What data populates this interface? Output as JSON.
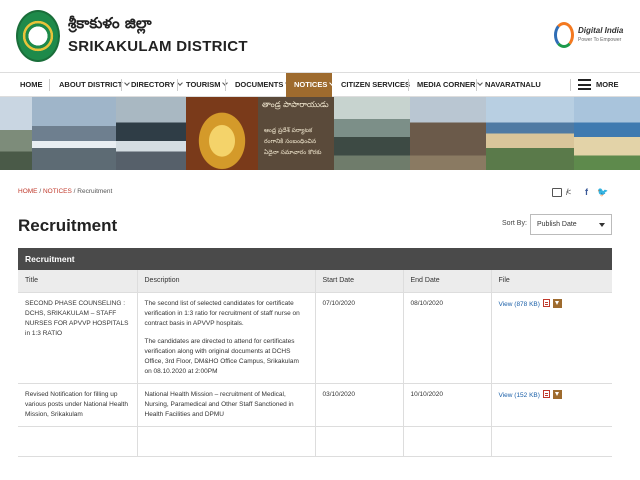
{
  "header": {
    "district_telugu": "శ్రీకాకుళం జిల్లా",
    "district_name": "SRIKAKULAM DISTRICT",
    "digital_india_title": "Digital India",
    "digital_india_tagline": "Power To Empower"
  },
  "nav": {
    "items": [
      {
        "label": "HOME"
      },
      {
        "label": "ABOUT DISTRICT"
      },
      {
        "label": "DIRECTORY"
      },
      {
        "label": "TOURISM"
      },
      {
        "label": "DOCUMENTS"
      },
      {
        "label": "NOTICES"
      },
      {
        "label": "CITIZEN SERVICES"
      },
      {
        "label": "MEDIA CORNER"
      },
      {
        "label": "NAVARATNALU"
      }
    ],
    "more_label": "MORE",
    "active_color": "#9e6b2e"
  },
  "banner": {
    "heading": "తాండ్ర పాపారాయుడు",
    "lines": [
      "ఆంధ్ర ప్రదేశ్ పర్యాటక",
      "రంగానికి సంబంధించిన",
      "ఏదైనా సమాచారం కొరకు"
    ]
  },
  "breadcrumb": {
    "home": "HOME",
    "notices": "NOTICES",
    "current": "Recruitment",
    "separator": "/"
  },
  "share": {
    "separator": "/",
    "facebook": "f",
    "twitter": "🐦"
  },
  "page": {
    "title": "Recruitment",
    "sort_label": "Sort By:",
    "sort_value": "Publish Date"
  },
  "table": {
    "caption": "Recruitment",
    "columns": [
      "Title",
      "Description",
      "Start Date",
      "End Date",
      "File"
    ],
    "rows": [
      {
        "title": "SECOND PHASE COUNSELING : DCHS, SRIKAKULAM – STAFF NURSES FOR APVVP HOSPITALS in 1:3 RATIO",
        "description": [
          "The second list of selected candidates for certificate verification in 1:3 ratio for recruitment of staff nurse on contract basis in APVVP hospitals.",
          "The candidates are directed to attend for certificates verification along with original documents at DCHS Office, 3rd Floor, DM&HO Office Campus, Srikakulam on 08.10.2020 at 2:00PM"
        ],
        "start_date": "07/10/2020",
        "end_date": "08/10/2020",
        "file": "View (878 KB)"
      },
      {
        "title": "Revised Notification for filling up various posts under National Health Mission, Srikakulam",
        "description": [
          "National Health Mission – recruitment of Medical, Nursing, Paramedical and Other Staff Sanctioned in Health Facilities and DPMU"
        ],
        "start_date": "03/10/2020",
        "end_date": "10/10/2020",
        "file": "View (152 KB)"
      },
      {
        "title": "",
        "description": [
          ""
        ],
        "start_date": "",
        "end_date": "",
        "file": ""
      }
    ]
  }
}
